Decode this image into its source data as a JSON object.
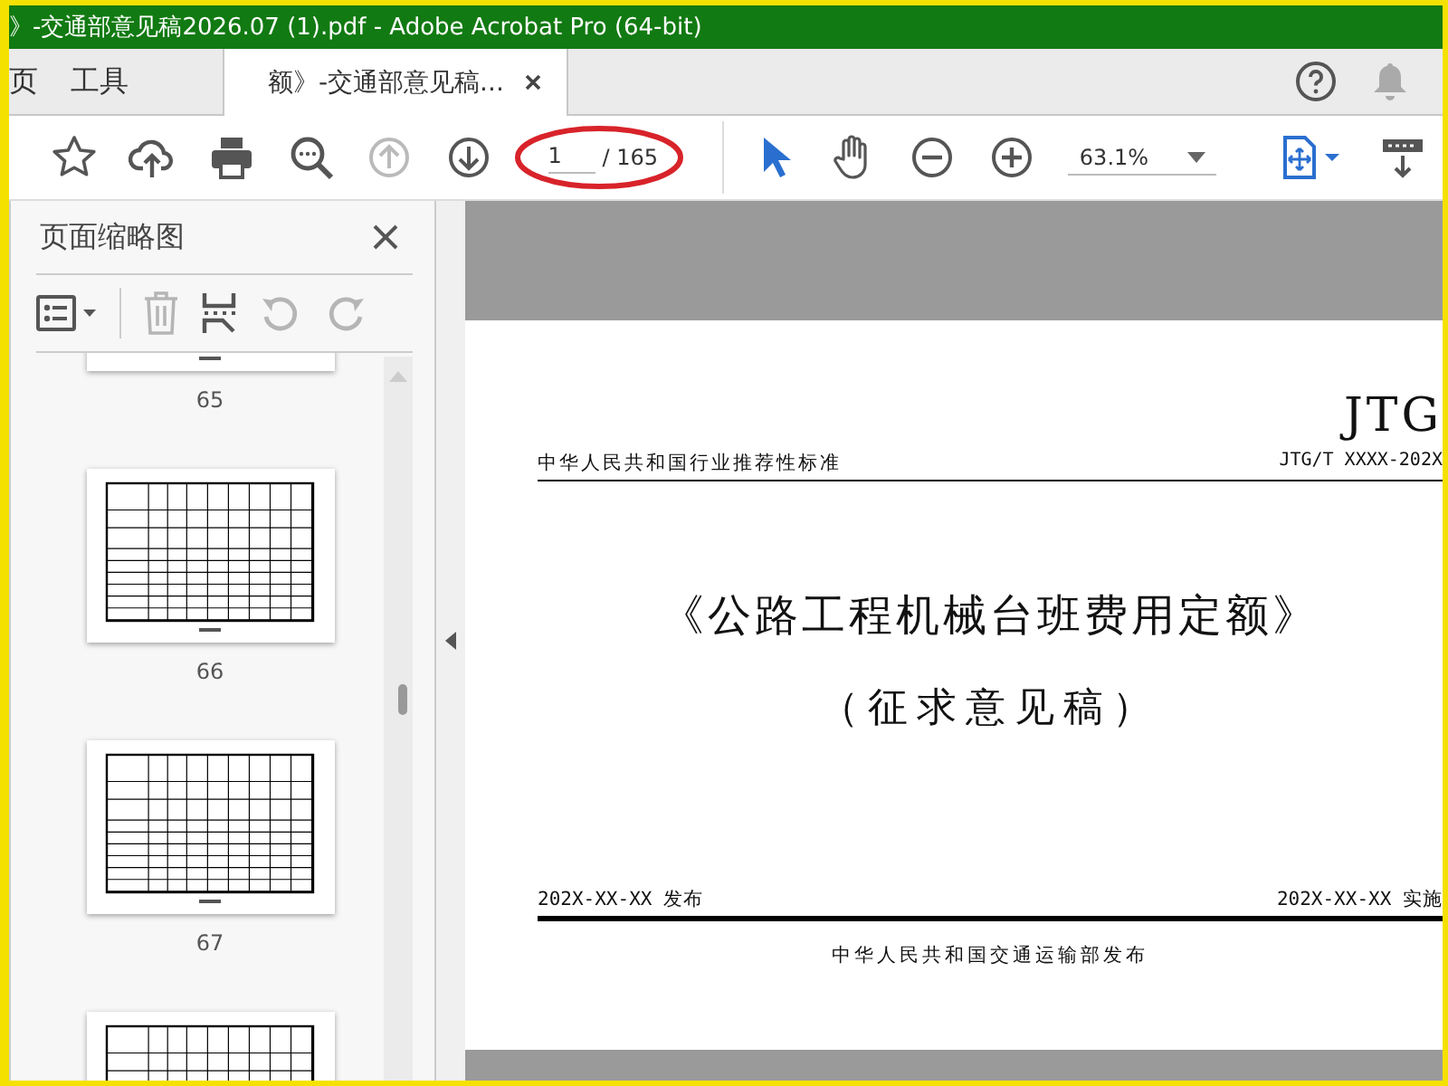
{
  "window": {
    "title": "》-交通部意见稿2026.07 (1).pdf - Adobe Acrobat Pro (64-bit)"
  },
  "tabs": [
    {
      "label": "页",
      "selected": false,
      "closable": false
    },
    {
      "label": "工具",
      "selected": false,
      "closable": false
    },
    {
      "label": "额》-交通部意见稿...",
      "selected": true,
      "closable": true
    }
  ],
  "toolbar": [
    {
      "kind": "bookmark",
      "disabled": false
    },
    {
      "kind": "upload",
      "disabled": false
    },
    {
      "kind": "print",
      "disabled": false
    },
    {
      "kind": "find",
      "disabled": false
    },
    {
      "kind": "prev",
      "disabled": true
    },
    {
      "kind": "next",
      "disabled": false
    },
    {
      "kind": "page",
      "value": "1",
      "total": "/ 165"
    },
    {
      "kind": "select",
      "selected": true
    },
    {
      "kind": "hand",
      "selected": false
    },
    {
      "kind": "zoom_out",
      "disabled": false
    },
    {
      "kind": "zoom_in",
      "disabled": false
    },
    {
      "kind": "zoom",
      "value": "63.1%"
    },
    {
      "kind": "fit",
      "disabled": false
    },
    {
      "kind": "read",
      "disabled": false
    }
  ],
  "sidebar": {
    "title": "页面缩略图",
    "tools": [
      {
        "kind": "options",
        "disabled": false
      },
      {
        "kind": "delete",
        "disabled": true
      },
      {
        "kind": "extract",
        "disabled": false
      },
      {
        "kind": "rotate_left",
        "disabled": true
      },
      {
        "kind": "rotate_right",
        "disabled": true
      }
    ],
    "thumbnails": [
      {
        "kind": "page",
        "label": "65"
      },
      {
        "kind": "page",
        "label": "66"
      },
      {
        "kind": "page",
        "label": "67"
      },
      {
        "kind": "page"
      }
    ]
  },
  "document": {
    "header_mark": "JTG",
    "category": "中华人民共和国行业推荐性标准",
    "code": "JTG/T XXXX-202X",
    "title": "《公路工程机械台班费用定额》",
    "subtitle": "（征求意见稿）",
    "publish_date": "202X-XX-XX 发布",
    "effective_date": "202X-XX-XX 实施",
    "publisher": "中华人民共和国交通运输部发布"
  }
}
